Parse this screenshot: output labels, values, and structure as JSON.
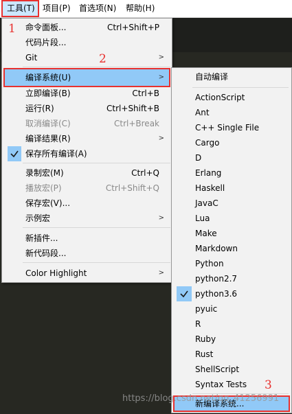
{
  "menubar": [
    {
      "label": "工具(T)",
      "active": true
    },
    {
      "label": "项目(P)"
    },
    {
      "label": "首选项(N)"
    },
    {
      "label": "帮助(H)"
    }
  ],
  "tools_menu": {
    "items": [
      {
        "label": "命令面板...",
        "shortcut": "Ctrl+Shift+P"
      },
      {
        "label": "代码片段..."
      },
      {
        "label": "Git",
        "submenu": true
      },
      {
        "label": "编译系统(U)",
        "submenu": true,
        "highlighted": true
      },
      {
        "label": "立即编译(B)",
        "shortcut": "Ctrl+B"
      },
      {
        "label": "运行(R)",
        "shortcut": "Ctrl+Shift+B"
      },
      {
        "label": "取消编译(C)",
        "shortcut": "Ctrl+Break",
        "disabled": true
      },
      {
        "label": "编译结果(R)",
        "submenu": true
      },
      {
        "label": "保存所有编译(A)",
        "checked": true
      },
      {
        "label": "录制宏(M)",
        "shortcut": "Ctrl+Q"
      },
      {
        "label": "播放宏(P)",
        "shortcut": "Ctrl+Shift+Q",
        "disabled": true
      },
      {
        "label": "保存宏(V)..."
      },
      {
        "label": "示例宏",
        "submenu": true
      },
      {
        "label": "新插件..."
      },
      {
        "label": "新代码段..."
      },
      {
        "label": "Color Highlight",
        "submenu": true
      }
    ]
  },
  "build_system_submenu": {
    "items": [
      {
        "label": "自动编译"
      },
      {
        "label": "ActionScript"
      },
      {
        "label": "Ant"
      },
      {
        "label": "C++ Single File"
      },
      {
        "label": "Cargo"
      },
      {
        "label": "D"
      },
      {
        "label": "Erlang"
      },
      {
        "label": "Haskell"
      },
      {
        "label": "JavaC"
      },
      {
        "label": "Lua"
      },
      {
        "label": "Make"
      },
      {
        "label": "Markdown"
      },
      {
        "label": "Python"
      },
      {
        "label": "python2.7"
      },
      {
        "label": "python3.6",
        "checked": true
      },
      {
        "label": "pyuic"
      },
      {
        "label": "R"
      },
      {
        "label": "Ruby"
      },
      {
        "label": "Rust"
      },
      {
        "label": "ShellScript"
      },
      {
        "label": "Syntax Tests"
      },
      {
        "label": "新编译系统...",
        "boxed": true
      }
    ]
  },
  "annotations": [
    "1",
    "2",
    "3"
  ],
  "watermark": "https://blog.csdn.net/qq_41256991",
  "colors": {
    "highlight": "#91c9f7",
    "annotation": "#e8312f",
    "editor_bg": "#272822"
  },
  "icons": {
    "check": "check-icon",
    "submenu": "chevron-right-icon"
  }
}
